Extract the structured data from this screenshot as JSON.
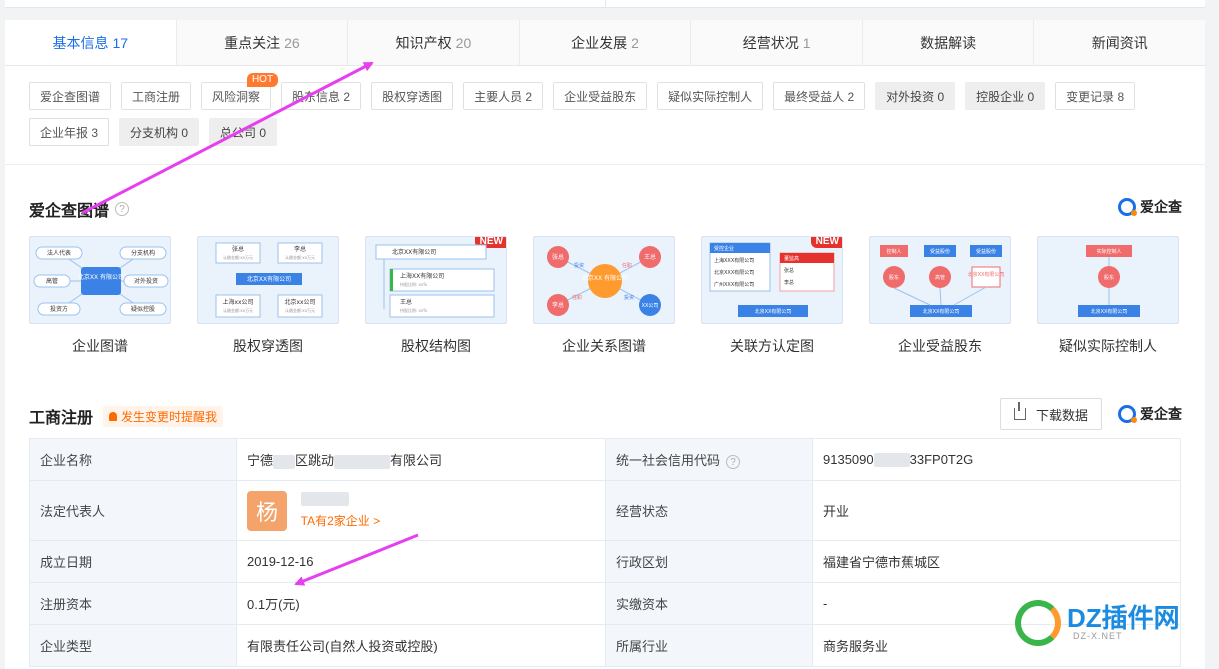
{
  "tabs": [
    {
      "label": "基本信息",
      "count": "17",
      "active": true
    },
    {
      "label": "重点关注",
      "count": "26"
    },
    {
      "label": "知识产权",
      "count": "20"
    },
    {
      "label": "企业发展",
      "count": "2"
    },
    {
      "label": "经营状况",
      "count": "1"
    },
    {
      "label": "数据解读",
      "count": ""
    },
    {
      "label": "新闻资讯",
      "count": ""
    }
  ],
  "subnav": [
    {
      "label": "爱企查图谱"
    },
    {
      "label": "工商注册"
    },
    {
      "label": "风险洞察",
      "badge": "HOT"
    },
    {
      "label": "股东信息 2"
    },
    {
      "label": "股权穿透图"
    },
    {
      "label": "主要人员 2"
    },
    {
      "label": "企业受益股东"
    },
    {
      "label": "疑似实际控制人"
    },
    {
      "label": "最终受益人 2"
    },
    {
      "label": "对外投资 0",
      "dim": true
    },
    {
      "label": "控股企业 0",
      "dim": true
    },
    {
      "label": "变更记录 8"
    },
    {
      "label": "企业年报 3"
    },
    {
      "label": "分支机构 0",
      "dim": true
    },
    {
      "label": "总公司 0",
      "dim": true
    }
  ],
  "graph_section": {
    "title": "爱企查图谱",
    "help": "?",
    "brand": "爱企查",
    "cards": [
      {
        "caption": "企业图谱",
        "new": ""
      },
      {
        "caption": "股权穿透图",
        "new": ""
      },
      {
        "caption": "股权结构图",
        "new": "NEW"
      },
      {
        "caption": "企业关系图谱",
        "new": ""
      },
      {
        "caption": "关联方认定图",
        "new": "NEW"
      },
      {
        "caption": "企业受益股东",
        "new": ""
      },
      {
        "caption": "疑似实际控制人",
        "new": ""
      }
    ],
    "thumb_text": {
      "center": "北京XX 有限公司",
      "legal": "法人代表",
      "branch": "分支机构",
      "exec": "高管",
      "invest_out": "对外投资",
      "investor": "投资方",
      "suspect": "疑似控股",
      "zhang": "张总",
      "li": "李总",
      "wang": "王总",
      "company_bj": "北京XX有限公司",
      "company_sh": "上海xx公司",
      "company_bj2": "北京xx公司",
      "company_sh2": "上海XX有限公司",
      "ratio": "认缴金额:xx万元",
      "hold": "持股比例: xx%",
      "invest": "投资",
      "position": "任职",
      "xx_company": "XX公司",
      "center2": "北京XX 有限公司",
      "control_co": "受控企业",
      "sh_co": "上海XXX有限公司",
      "bj_co": "北京XXX有限公司",
      "gz_co": "广州XXX有限公司",
      "dongshi": "董监高",
      "zhang2": "张总",
      "li2": "李总",
      "controller": "控制人",
      "benefit": "受益股份",
      "shareholder": "股东",
      "exec2": "高管",
      "bj_xx": "北京XX有限公司",
      "bj_xx2": "北京XX有限公司",
      "actual_ctrl": "实际控制人",
      "sh_xx": "北京XX有限公司",
      "bj_xx3": "北京XX有限公司",
      "bj_xx4": "北京XX有限公司"
    }
  },
  "registration": {
    "title": "工商注册",
    "alert": "发生变更时提醒我",
    "download": "下载数据",
    "brand": "爱企查",
    "rows": [
      {
        "k1": "企业名称",
        "v1a": "宁德",
        "v1b": "区跳动",
        "v1c": "有限公司",
        "k2": "统一社会信用代码",
        "v2a": "9135090",
        "v2b": "33FP0T2G"
      },
      {
        "k1": "法定代表人",
        "avatar": "杨",
        "ta": "TA有2家企业 >",
        "k2": "经营状态",
        "v2": "开业"
      },
      {
        "k1": "成立日期",
        "v1": "2019-12-16",
        "k2": "行政区划",
        "v2": "福建省宁德市蕉城区"
      },
      {
        "k1": "注册资本",
        "v1": "0.1万(元)",
        "k2": "实缴资本",
        "v2": "-"
      },
      {
        "k1": "企业类型",
        "v1": "有限责任公司(自然人投资或控股)",
        "k2": "所属行业",
        "v2": "商务服务业"
      }
    ]
  },
  "watermark": {
    "title": "DZ插件网",
    "sub": "DZ-X.NET"
  },
  "colors": {
    "accent": "#1a6ee8",
    "hot": "#ff7a2e",
    "new": "#e5322d",
    "arrow": "#e53ff0"
  }
}
